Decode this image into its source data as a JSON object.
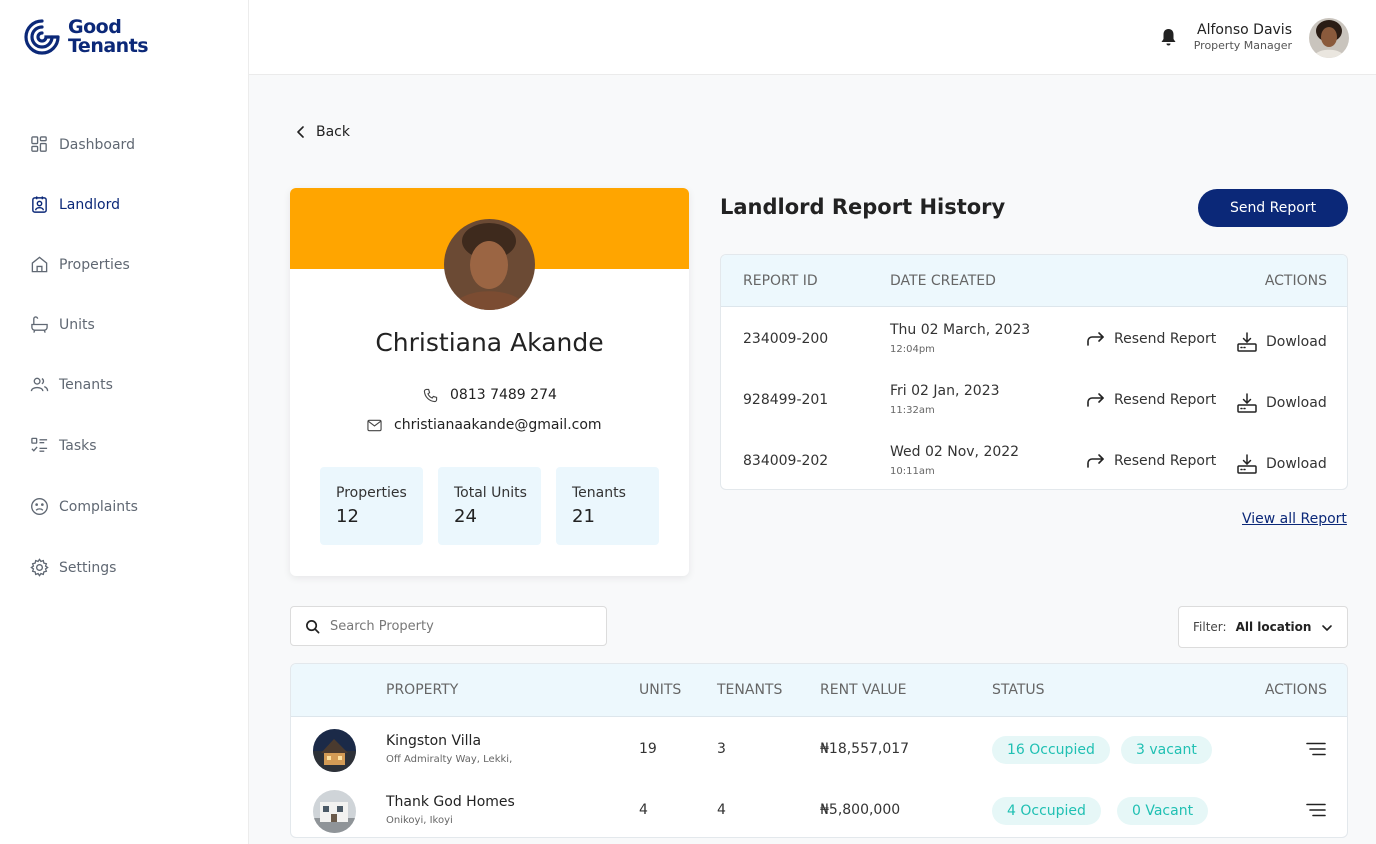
{
  "brand": {
    "line1": "Good",
    "line2": "Tenants"
  },
  "sidebar": {
    "items": [
      {
        "label": "Dashboard",
        "icon": "dashboard-icon"
      },
      {
        "label": "Landlord",
        "icon": "landlord-icon",
        "active": true
      },
      {
        "label": "Properties",
        "icon": "home-icon"
      },
      {
        "label": "Units",
        "icon": "bathtub-icon"
      },
      {
        "label": "Tenants",
        "icon": "users-icon"
      },
      {
        "label": "Tasks",
        "icon": "checklist-icon"
      },
      {
        "label": "Complaints",
        "icon": "sad-face-icon"
      },
      {
        "label": "Settings",
        "icon": "gear-icon"
      }
    ]
  },
  "topbar": {
    "user_name": "Alfonso Davis",
    "user_role": "Property Manager"
  },
  "back_label": "Back",
  "landlord": {
    "name": "Christiana Akande",
    "phone": "0813 7489 274",
    "email": "christianaakande@gmail.com",
    "stats": [
      {
        "label": "Properties",
        "value": "12"
      },
      {
        "label": "Total Units",
        "value": "24"
      },
      {
        "label": "Tenants",
        "value": "21"
      }
    ]
  },
  "reports": {
    "title": "Landlord Report History",
    "send_label": "Send Report",
    "columns": {
      "id": "REPORT ID",
      "date": "DATE CREATED",
      "actions": "ACTIONS"
    },
    "rows": [
      {
        "id": "234009-200",
        "date": "Thu 02 March, 2023",
        "time": "12:04pm"
      },
      {
        "id": "928499-201",
        "date": "Fri 02 Jan, 2023",
        "time": "11:32am"
      },
      {
        "id": "834009-202",
        "date": "Wed 02 Nov, 2022",
        "time": "10:11am"
      }
    ],
    "resend_label": "Resend Report",
    "download_label": "Dowload",
    "view_all_label": "View all Report"
  },
  "search": {
    "placeholder": "Search Property"
  },
  "filter": {
    "label": "Filter:",
    "value": "All location"
  },
  "properties": {
    "columns": {
      "property": "PROPERTY",
      "units": "UNITS",
      "tenants": "TENANTS",
      "rent": "RENT VALUE",
      "status": "STATUS",
      "actions": "ACTIONS"
    },
    "rows": [
      {
        "name": "Kingston Villa",
        "address": "Off Admiralty Way, Lekki,",
        "units": "19",
        "tenants": "3",
        "rent": "₦18,557,017",
        "occupied": "16 Occupied",
        "vacant": "3 vacant"
      },
      {
        "name": "Thank God Homes",
        "address": "Onikoyi, Ikoyi",
        "units": "4",
        "tenants": "4",
        "rent": "₦5,800,000",
        "occupied": "4 Occupied",
        "vacant": "0 Vacant"
      }
    ]
  },
  "colors": {
    "brand": "#0b2878",
    "banner": "#ffa500",
    "badge_text": "#20c0b3",
    "header_bg": "#edf8fd"
  }
}
